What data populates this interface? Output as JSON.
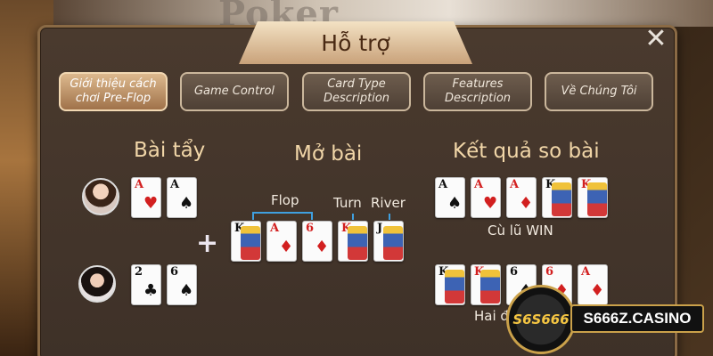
{
  "background": {
    "logo_text": "Poker"
  },
  "dialog": {
    "title": "Hỗ trợ",
    "close_symbol": "✕"
  },
  "tabs": [
    {
      "label": "Giới thiệu cách chơi Pre-Flop",
      "active": true
    },
    {
      "label": "Game Control",
      "active": false
    },
    {
      "label": "Card Type Description",
      "active": false
    },
    {
      "label": "Features Description",
      "active": false
    },
    {
      "label": "Về Chúng Tôi",
      "active": false
    }
  ],
  "sections": {
    "hole_cards": "Bài tẩy",
    "community": "Mở bài",
    "result": "Kết quả so bài"
  },
  "players": [
    {
      "avatar": "female-player-avatar",
      "cards": [
        {
          "rank": "A",
          "suit": "♥",
          "color": "red"
        },
        {
          "rank": "A",
          "suit": "♠",
          "color": "black"
        }
      ]
    },
    {
      "avatar": "female-player-avatar",
      "cards": [
        {
          "rank": "2",
          "suit": "♣",
          "color": "black"
        },
        {
          "rank": "6",
          "suit": "♠",
          "color": "black"
        }
      ]
    }
  ],
  "board": {
    "labels": {
      "flop": "Flop",
      "turn": "Turn",
      "river": "River"
    },
    "cards": [
      {
        "rank": "K",
        "suit": "♣",
        "color": "black",
        "face": true
      },
      {
        "rank": "A",
        "suit": "♦",
        "color": "red",
        "face": false
      },
      {
        "rank": "6",
        "suit": "♦",
        "color": "red",
        "face": false
      },
      {
        "rank": "K",
        "suit": "♦",
        "color": "red",
        "face": true
      },
      {
        "rank": "J",
        "suit": "♣",
        "color": "black",
        "face": true
      }
    ],
    "plus": "+"
  },
  "results": [
    {
      "caption": "Cù lũ WIN",
      "cards": [
        {
          "rank": "A",
          "suit": "♠",
          "color": "black",
          "face": false
        },
        {
          "rank": "A",
          "suit": "♥",
          "color": "red",
          "face": false
        },
        {
          "rank": "A",
          "suit": "♦",
          "color": "red",
          "face": false
        },
        {
          "rank": "K",
          "suit": "♣",
          "color": "black",
          "face": true
        },
        {
          "rank": "K",
          "suit": "♦",
          "color": "red",
          "face": true
        }
      ]
    },
    {
      "caption": "Hai đ",
      "cards": [
        {
          "rank": "K",
          "suit": "♣",
          "color": "black",
          "face": true
        },
        {
          "rank": "K",
          "suit": "♦",
          "color": "red",
          "face": true
        },
        {
          "rank": "6",
          "suit": "♠",
          "color": "black",
          "face": false
        },
        {
          "rank": "6",
          "suit": "♦",
          "color": "red",
          "face": false
        },
        {
          "rank": "A",
          "suit": "♦",
          "color": "red",
          "face": false
        }
      ]
    }
  ],
  "watermark": {
    "circle_text": "S6S666",
    "badge_text": "S666Z.CASINO"
  }
}
